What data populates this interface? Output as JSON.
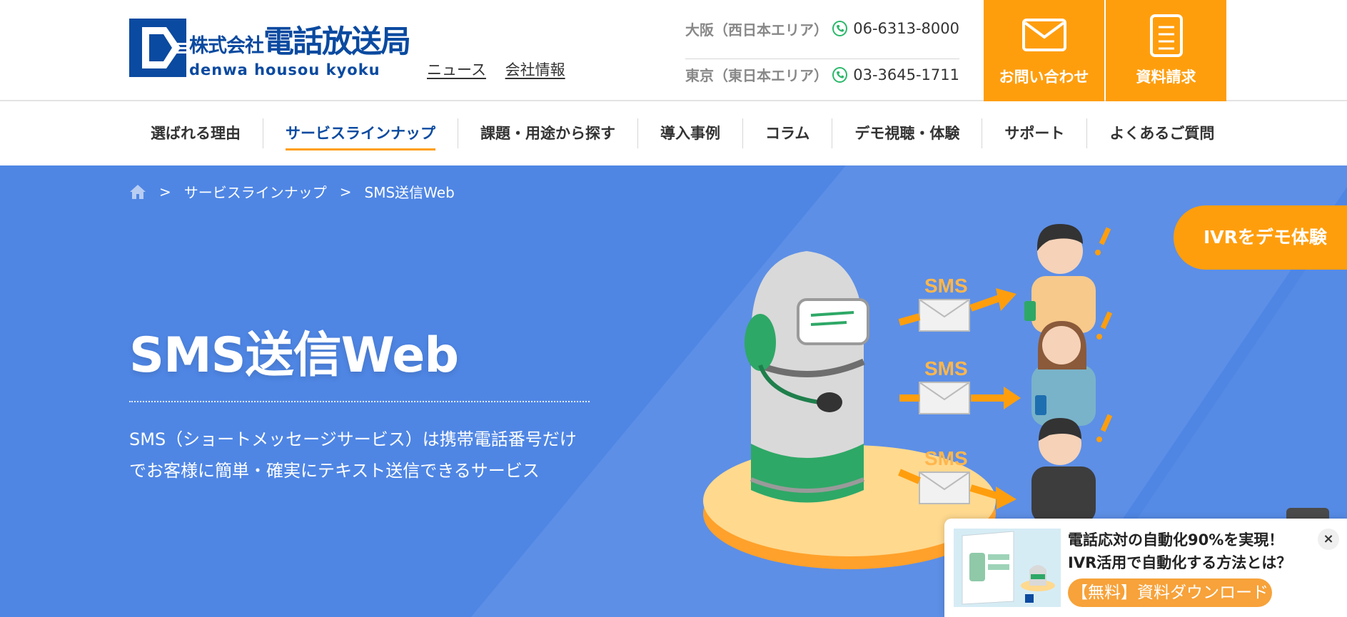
{
  "header": {
    "logo": {
      "jp_small": "株式会社",
      "jp_big": "電話放送局",
      "en": "denwa housou kyoku"
    },
    "top_links": [
      "ニュース",
      "会社情報"
    ],
    "contacts": [
      {
        "area": "大阪（西日本エリア）",
        "number": "06-6313-8000"
      },
      {
        "area": "東京（東日本エリア）",
        "number": "03-3645-1711"
      }
    ],
    "cta_inquiry": "お問い合わせ",
    "cta_request": "資料請求"
  },
  "nav": {
    "items": [
      "選ばれる理由",
      "サービスラインナップ",
      "課題・用途から探す",
      "導入事例",
      "コラム",
      "デモ視聴・体験",
      "サポート",
      "よくあるご質問"
    ],
    "active": "サービスラインナップ"
  },
  "breadcrumb": {
    "sep": ">",
    "items": [
      "サービスラインナップ",
      "SMS送信Web"
    ]
  },
  "hero": {
    "title": "SMS送信Web",
    "desc_line1": "SMS（ショートメッセージサービス）は携帯電話番号だけ",
    "desc_line2": "でお客様に簡単・確実にテキスト送信できるサービス",
    "illus_label": "SMS"
  },
  "demo_tab": "IVRをデモ体験",
  "popup": {
    "line1": "電話応対の自動化90%を実現！",
    "line2": "IVR活用で自動化する方法とは？",
    "button": "【無料】資料ダウンロード",
    "close": "×"
  },
  "colors": {
    "brand_blue": "#0a4aa0",
    "accent_orange": "#ff9e0d",
    "hero_blue": "#4f86e4",
    "phone_green": "#2bb86a"
  }
}
